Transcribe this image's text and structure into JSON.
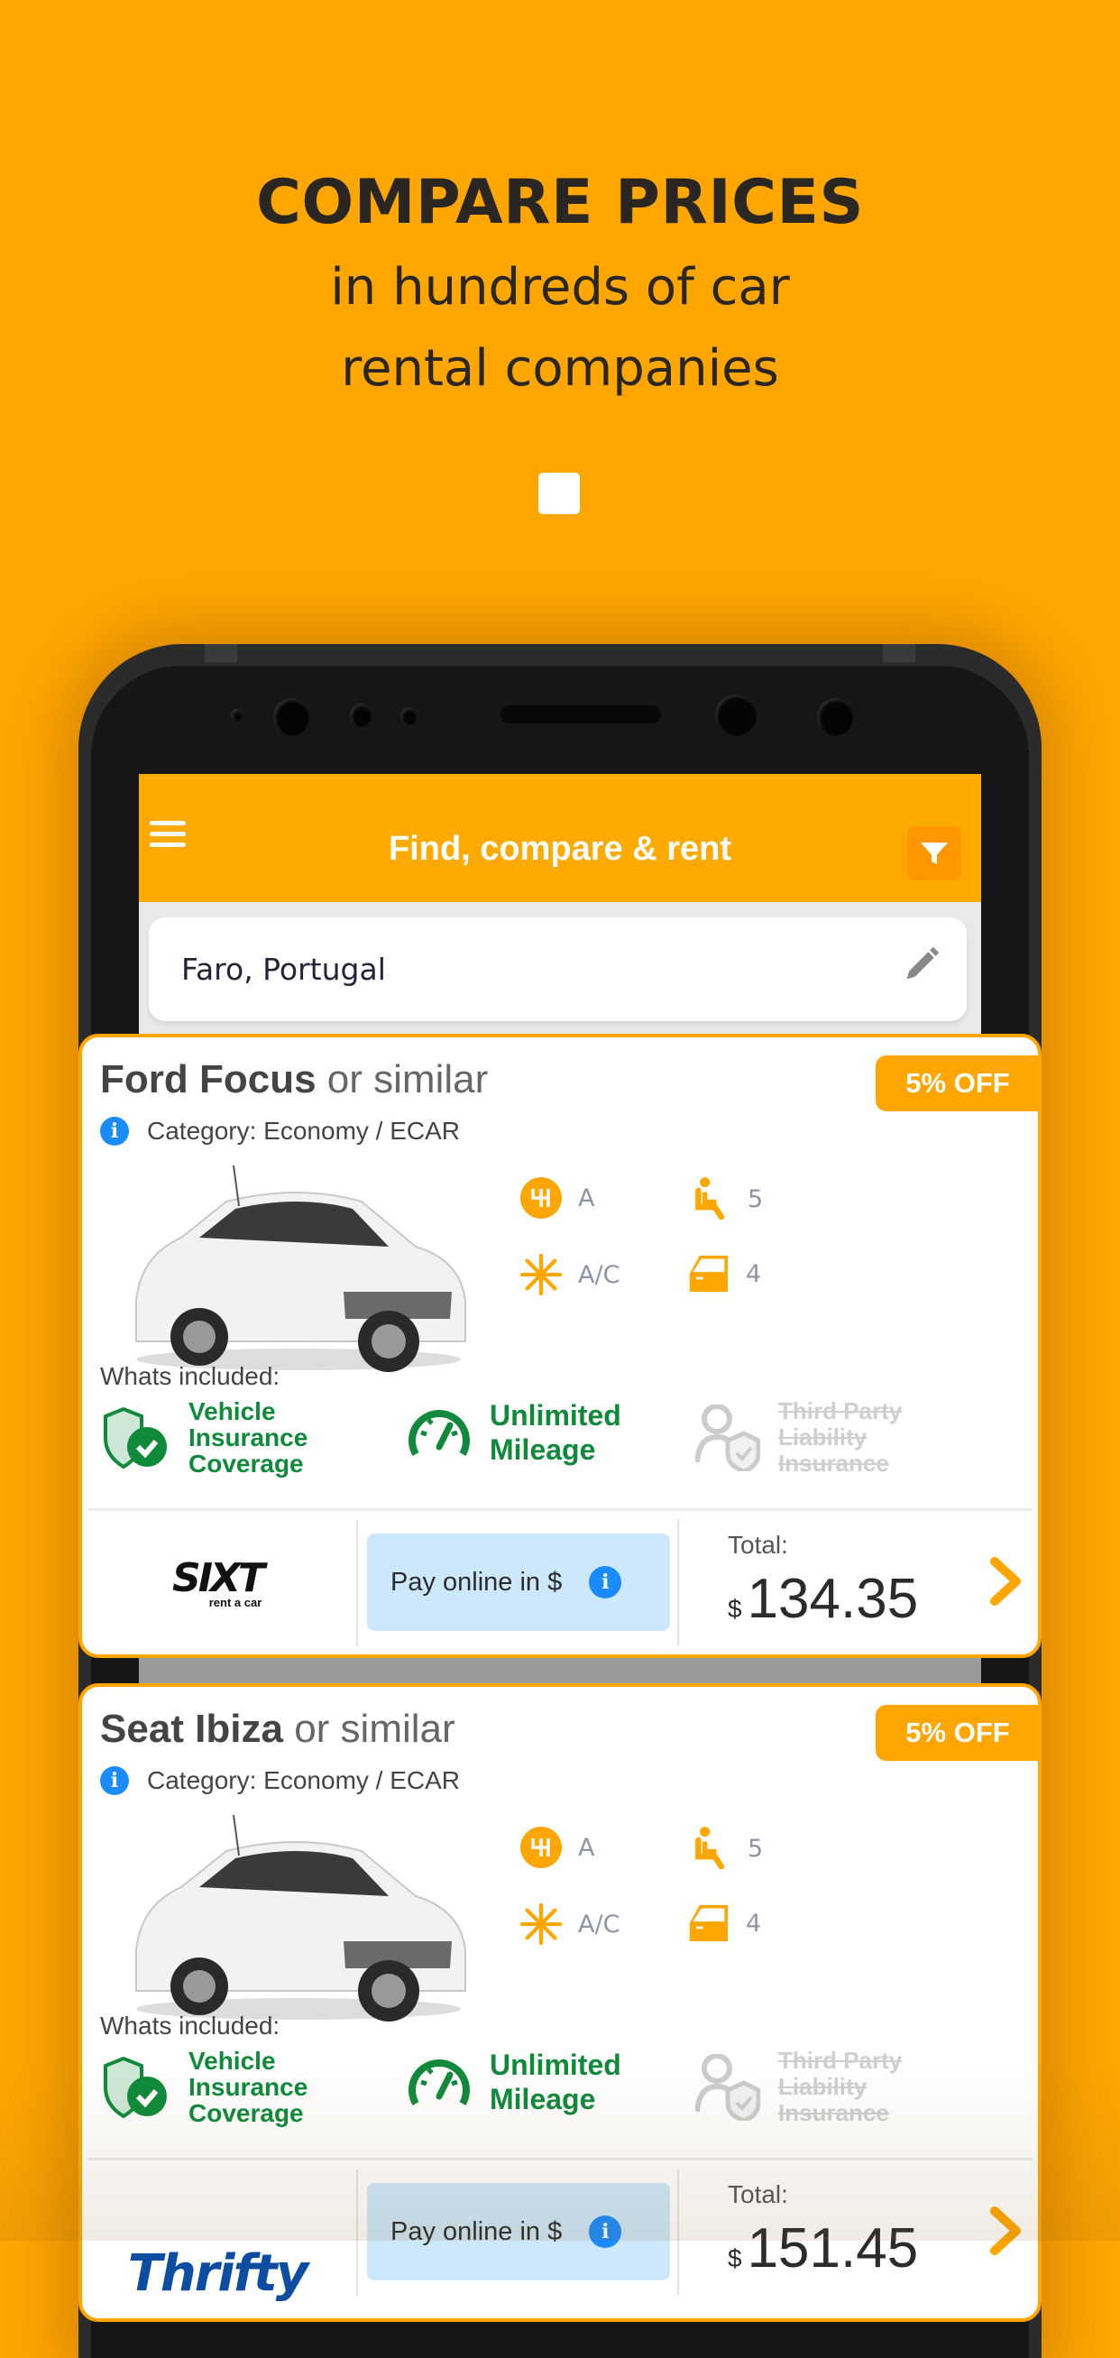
{
  "promo": {
    "headline": "COMPARE PRICES",
    "subline1": "in hundreds of car",
    "subline2": "rental companies"
  },
  "app": {
    "title": "Find, compare & rent",
    "menu_icon": "hamburger-menu-icon",
    "filter_icon": "filter-funnel-icon",
    "search": {
      "value": "Faro, Portugal",
      "edit_icon": "pencil-icon"
    }
  },
  "colors": {
    "brand": "#FFA600",
    "appbar": "#FFAA00",
    "included_green": "#0E8A3A",
    "info_blue": "#1A8CFF",
    "pay_bg": "#CDE8FB"
  },
  "offers": [
    {
      "model": "Ford Focus",
      "similar": "or similar",
      "discount": "5% OFF",
      "category": "Category: Economy / ECAR",
      "specs": {
        "transmission": "A",
        "seats": "5",
        "ac": "A/C",
        "doors": "4"
      },
      "included_label": "Whats included:",
      "included": [
        {
          "label": "Vehicle Insurance Coverage",
          "lines": [
            "Vehicle",
            "Insurance",
            "Coverage"
          ],
          "included": true,
          "icon": "shield-check-icon"
        },
        {
          "label": "Unlimited Mileage",
          "lines": [
            "Unlimited",
            "Mileage"
          ],
          "included": true,
          "icon": "speedometer-icon"
        },
        {
          "label": "Third Party Liability Insurance",
          "lines": [
            "Third Party",
            "Liability",
            "Insurance"
          ],
          "included": false,
          "icon": "person-shield-icon"
        }
      ],
      "supplier": "SIXT",
      "supplier_tagline": "rent a car",
      "pay_label": "Pay online in $",
      "total_label": "Total:",
      "currency": "$",
      "price": "134.35"
    },
    {
      "model": "Seat Ibiza",
      "similar": "or similar",
      "discount": "5% OFF",
      "category": "Category: Economy / ECAR",
      "specs": {
        "transmission": "A",
        "seats": "5",
        "ac": "A/C",
        "doors": "4"
      },
      "included_label": "Whats included:",
      "included": [
        {
          "label": "Vehicle Insurance Coverage",
          "lines": [
            "Vehicle",
            "Insurance",
            "Coverage"
          ],
          "included": true,
          "icon": "shield-check-icon"
        },
        {
          "label": "Unlimited Mileage",
          "lines": [
            "Unlimited",
            "Mileage"
          ],
          "included": true,
          "icon": "speedometer-icon"
        },
        {
          "label": "Third Party Liability Insurance",
          "lines": [
            "Third Party",
            "Liability",
            "Insurance"
          ],
          "included": false,
          "icon": "person-shield-icon"
        }
      ],
      "supplier": "Thrifty",
      "pay_label": "Pay online in $",
      "total_label": "Total:",
      "currency": "$",
      "price": "151.45"
    }
  ]
}
